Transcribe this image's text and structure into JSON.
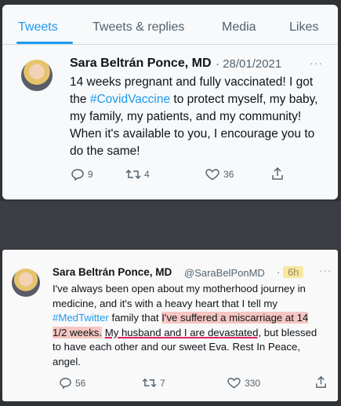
{
  "tabs": [
    {
      "label": "Tweets",
      "active": true
    },
    {
      "label": "Tweets & replies",
      "active": false
    },
    {
      "label": "Media",
      "active": false
    },
    {
      "label": "Likes",
      "active": false
    }
  ],
  "tweet1": {
    "name": "Sara Beltrán Ponce, MD",
    "date": "· 28/01/2021",
    "more": "···",
    "text_part1": "14 weeks pregnant and fully vaccinated! I got the ",
    "hashtag": "#CovidVaccine",
    "text_part2": " to protect myself, my baby, my family, my patients, and my community! When it's available to you, I encourage you to do the same!",
    "replies": "9",
    "retweets": "4",
    "likes": "36"
  },
  "tweet2": {
    "name": "Sara Beltrán Ponce, MD",
    "handle": "@SaraBelPonMD",
    "time": "6h",
    "more": "···",
    "text_part1": "I've always been open about my motherhood journey in medicine, and it's with a heavy heart that I tell my ",
    "hashtag": "#MedTwitter",
    "text_part2": " family that ",
    "highlight": "I've suffered a miscarriage at 14 1/2 weeks.",
    "text_part3": " ",
    "underlined": "My husband and I are devastated,",
    "text_part4": " but blessed to have each other and our sweet Eva. Rest In Peace, angel.",
    "replies": "56",
    "retweets": "7",
    "likes": "330"
  },
  "colors": {
    "accent": "#1d9bf0",
    "highlight": "#f6c6c2",
    "underline": "#e0245e"
  },
  "icons": [
    "reply-icon",
    "retweet-icon",
    "like-icon",
    "share-icon",
    "more-icon",
    "avatar"
  ]
}
